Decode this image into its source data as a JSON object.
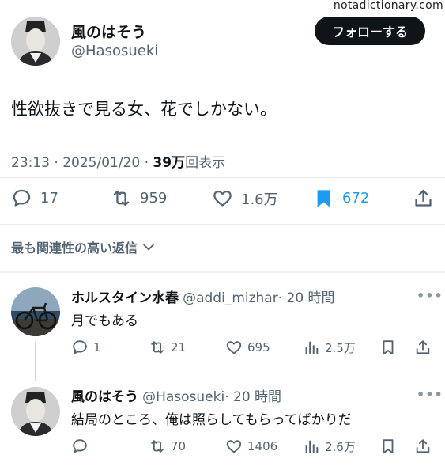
{
  "watermark": "notadictionary.com",
  "tweet": {
    "author_name": "風のはそう",
    "author_handle": "@Hasosueki",
    "follow_label": "フォローする",
    "text": "性欲抜きで見る女、花でしかない。",
    "time": "23:13 · 2025/01/20 · ",
    "views_count": "39万",
    "views_label": "回表示",
    "replies": "17",
    "retweets": "959",
    "likes": "1.6万",
    "bookmarks": "672",
    "bookmark_color": "#1d9bf0"
  },
  "sort_label": "最も関連性の高い返信",
  "replies": [
    {
      "name": "ホルスタイン水春",
      "handle": "@addi_mizhar",
      "time": "· 20 時間",
      "text": "月でもある",
      "replies": "1",
      "retweets": "21",
      "likes": "695",
      "views": "2.5万"
    },
    {
      "name": "風のはそう",
      "handle": "@Hasosueki",
      "time": "· 20 時間",
      "text": "結局のところ、俺は照らしてもらってばかりだ",
      "replies": "",
      "retweets": "70",
      "likes": "1406",
      "views": "2.6万"
    }
  ],
  "icons": {
    "reply": "speech-bubble-icon",
    "retweet": "retweet-arrows-icon",
    "like": "heart-icon",
    "bookmark": "bookmark-icon",
    "share": "share-upload-icon",
    "views": "bar-chart-icon",
    "more": "more-dots-icon",
    "chevron": "chevron-down-icon"
  }
}
